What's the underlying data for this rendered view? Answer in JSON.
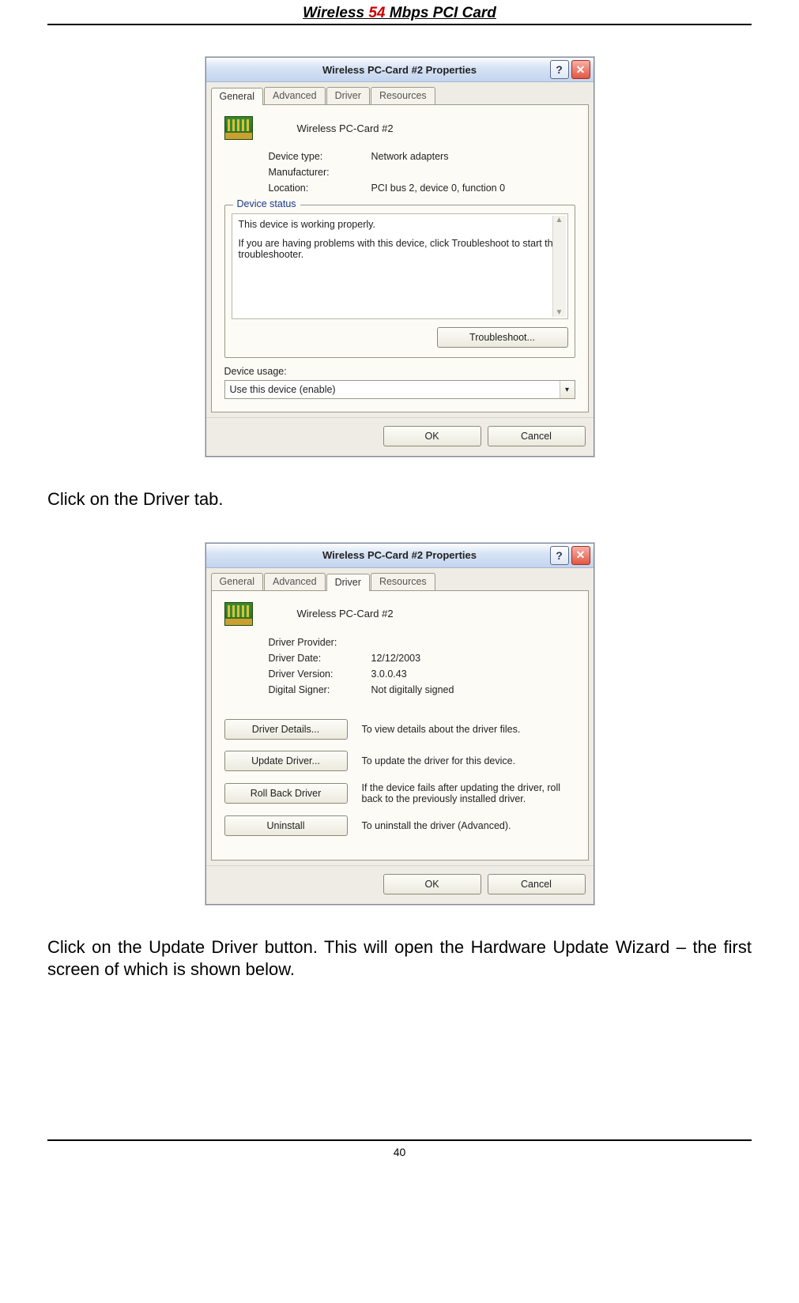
{
  "header": {
    "prefix": "Wireless ",
    "accent": "54",
    "suffix": " Mbps PCI Card"
  },
  "text": {
    "instruction1": "Click on the Driver tab.",
    "instruction2": "Click on the Update Driver button.  This will open the Hardware Update Wizard – the first screen of which is shown below."
  },
  "dialog1": {
    "title": "Wireless PC-Card #2 Properties",
    "help_label": "?",
    "close_label": "✕",
    "tabs": [
      "General",
      "Advanced",
      "Driver",
      "Resources"
    ],
    "active_tab_index": 0,
    "device_name": "Wireless PC-Card #2",
    "fields": {
      "device_type_label": "Device type:",
      "device_type_value": "Network adapters",
      "manufacturer_label": "Manufacturer:",
      "manufacturer_value": "",
      "location_label": "Location:",
      "location_value": "PCI bus 2, device 0, function 0"
    },
    "status_group_label": "Device status",
    "status_line1": "This device is working properly.",
    "status_line2": "If you are having problems with this device, click Troubleshoot to start the troubleshooter.",
    "troubleshoot_label": "Troubleshoot...",
    "usage_label": "Device usage:",
    "usage_value": "Use this device (enable)",
    "ok_label": "OK",
    "cancel_label": "Cancel"
  },
  "dialog2": {
    "title": "Wireless PC-Card #2 Properties",
    "help_label": "?",
    "close_label": "✕",
    "tabs": [
      "General",
      "Advanced",
      "Driver",
      "Resources"
    ],
    "active_tab_index": 2,
    "device_name": "Wireless PC-Card #2",
    "fields": {
      "provider_label": "Driver Provider:",
      "provider_value": "",
      "date_label": "Driver Date:",
      "date_value": "12/12/2003",
      "version_label": "Driver Version:",
      "version_value": "3.0.0.43",
      "signer_label": "Digital Signer:",
      "signer_value": "Not digitally signed"
    },
    "actions": {
      "details_label": "Driver Details...",
      "details_desc": "To view details about the driver files.",
      "update_label": "Update Driver...",
      "update_desc": "To update the driver for this device.",
      "rollback_label": "Roll Back Driver",
      "rollback_desc": "If the device fails after updating the driver, roll back to the previously installed driver.",
      "uninstall_label": "Uninstall",
      "uninstall_desc": "To uninstall the driver (Advanced)."
    },
    "ok_label": "OK",
    "cancel_label": "Cancel"
  },
  "page_number": "40"
}
